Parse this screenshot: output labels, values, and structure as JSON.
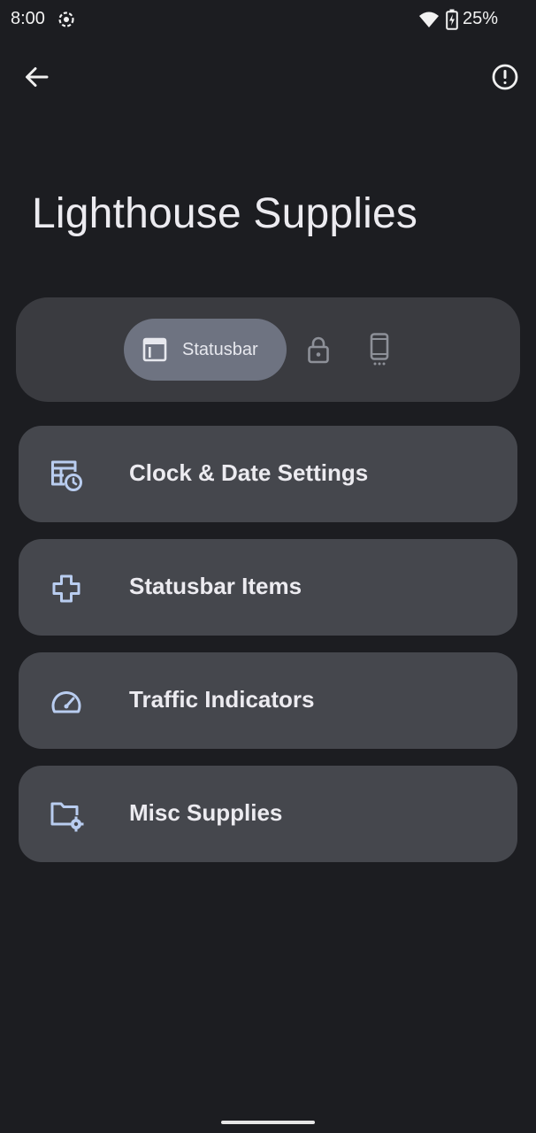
{
  "status_bar": {
    "time": "8:00",
    "battery": "25%",
    "icons": [
      "sync-icon",
      "wifi-icon",
      "battery-charging-icon"
    ]
  },
  "toolbar": {
    "back_icon": "arrow-back-icon",
    "info_icon": "info-alert-icon"
  },
  "title": "Lighthouse Supplies",
  "segments": [
    {
      "label": "Statusbar",
      "icon": "statusbar-icon",
      "selected": true
    },
    {
      "label": "",
      "icon": "lock-icon",
      "selected": false
    },
    {
      "label": "",
      "icon": "phone-icon",
      "selected": false
    }
  ],
  "menu": [
    {
      "label": "Clock & Date Settings",
      "icon": "calendar-clock-icon"
    },
    {
      "label": "Statusbar Items",
      "icon": "plus-icon"
    },
    {
      "label": "Traffic Indicators",
      "icon": "speedometer-icon"
    },
    {
      "label": "Misc Supplies",
      "icon": "folder-settings-icon"
    }
  ],
  "colors": {
    "background": "#1c1d21",
    "selector_card": "#3a3b40",
    "selected_segment": "#6e7381",
    "menu_card": "#45474d",
    "icon_accent": "#b9cdf0",
    "text": "#ecebf0"
  }
}
